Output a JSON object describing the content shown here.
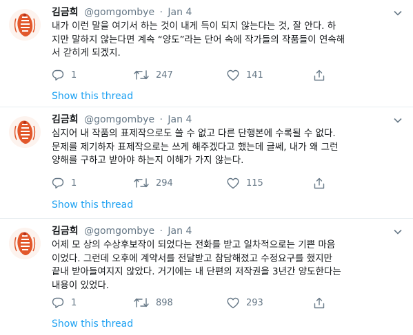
{
  "tweets": [
    {
      "name": "김금희",
      "handle": "@gomgombye",
      "separator": "·",
      "date": "Jan 4",
      "text": "내가 이런 말을 여기서 하는 것이 내게 득이 되지 않는다는 것, 잘 안다. 하\n지만 말하지 않는다면 계속 “양도”라는 단어 속에 작가들의 작품들이 연속해\n서 갇히게 되겠지.",
      "replies": "1",
      "retweets": "247",
      "likes": "141",
      "show_thread": "Show this thread"
    },
    {
      "name": "김금희",
      "handle": "@gomgombye",
      "separator": "·",
      "date": "Jan 4",
      "text": "심지어 내 작품의 표제작으로도 쓸 수 없고 다른 단행본에 수록될 수 없다.\n문제를 제기하자 표제작으로는 쓰게 해주겠다고 했는데 글쎄, 내가 왜 그런\n양해를 구하고 받아야 하는지 이해가 가지 않는다.",
      "replies": "1",
      "retweets": "294",
      "likes": "115",
      "show_thread": "Show this thread"
    },
    {
      "name": "김금희",
      "handle": "@gomgombye",
      "separator": "·",
      "date": "Jan 4",
      "text": "어제 모 상의 수상후보작이 되었다는 전화를 받고 일차적으로는 기쁜 마음\n이었다. 그런데 오후에 계약서를 전달받고 참담해졌고 수정요구를 했지만\n끝내 받아들여지지 않았다. 거기에는 내 단편의 저작권을 3년간 양도한다는\n내용이 있었다.",
      "replies": "1",
      "retweets": "898",
      "likes": "293",
      "show_thread": "Show this thread"
    }
  ],
  "icons": {
    "reply": "reply-icon",
    "retweet": "retweet-icon",
    "like": "like-icon",
    "more": "chevron-down-icon",
    "avatar": "avatar"
  },
  "colors": {
    "link": "#1da1f2",
    "secondary_text": "#657786",
    "primary_text": "#14171a",
    "divider": "#e6ecf0",
    "avatar_accent": "#e2572b"
  }
}
